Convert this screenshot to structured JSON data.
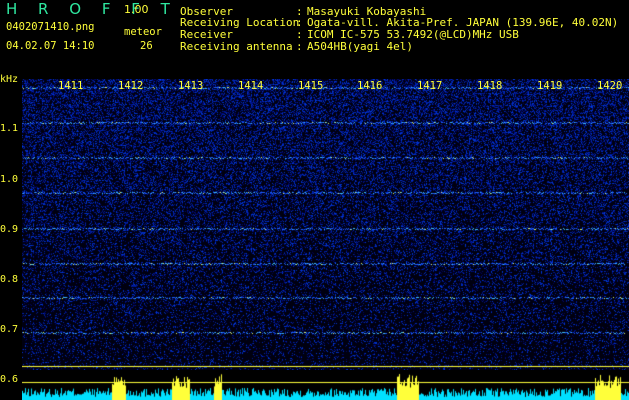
{
  "header": {
    "app_title": "H R O F F T",
    "version": "1.00",
    "filename": "0402071410.png",
    "datetime": "04.02.07 14:10",
    "meteor_label": "meteor",
    "meteor_count": "26"
  },
  "info": [
    {
      "label": "Observer",
      "value": "Masayuki Kobayashi"
    },
    {
      "label": "Receiving Location",
      "value": "Ogata-vill. Akita-Pref. JAPAN (139.96E, 40.02N)"
    },
    {
      "label": "Receiver",
      "value": "ICOM IC-575 53.7492(@LCD)MHz USB"
    },
    {
      "label": "Receiving antenna",
      "value": "A504HB(yagi 4el)"
    }
  ],
  "colon": ":",
  "axis": {
    "y_unit": "kHz",
    "y_ticks": [
      "1.1",
      "1.0",
      "0.9",
      "0.8",
      "0.7",
      "0.6"
    ],
    "x_ticks": [
      "1411",
      "1412",
      "1413",
      "1414",
      "1415",
      "1416",
      "1417",
      "1418",
      "1419",
      "1420"
    ]
  },
  "colors": {
    "background": "#000000",
    "text": "#ffff3a",
    "title": "#2fe8a0",
    "grid": "#ffff3a",
    "noise": "#0a1a7a",
    "line": "#30a0ff",
    "power": "#00e0ff"
  }
}
